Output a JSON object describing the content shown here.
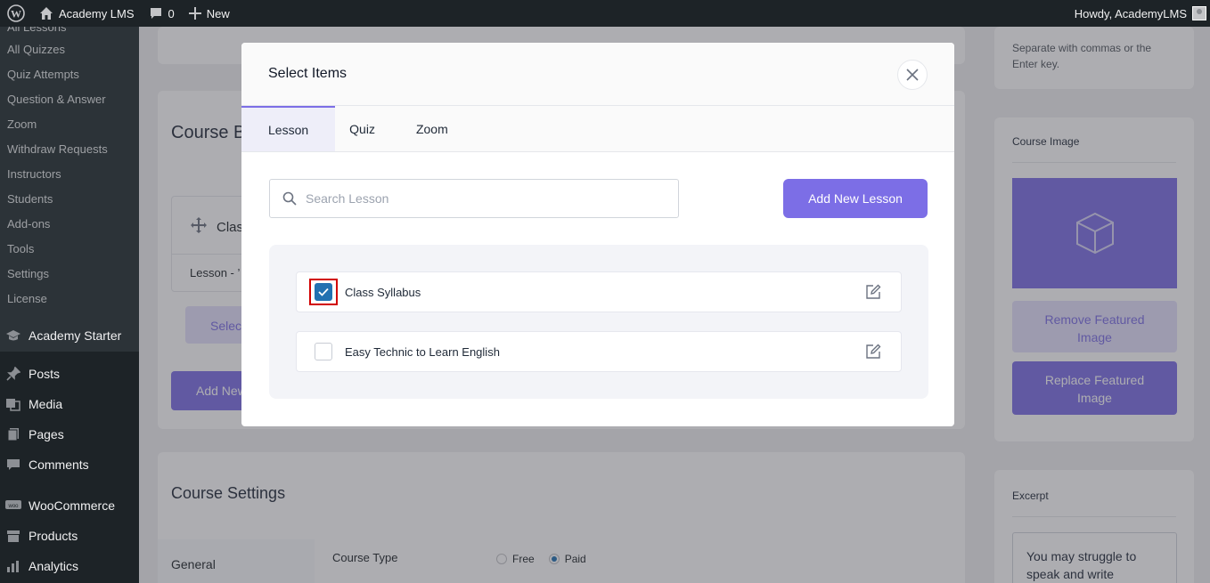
{
  "admin_bar": {
    "site_name": "Academy LMS",
    "comments_count": "0",
    "new_label": "New",
    "greeting": "Howdy, AcademyLMS"
  },
  "sidebar": {
    "partial_item": "All Lessons",
    "sub_items": [
      "All Quizzes",
      "Quiz Attempts",
      "Question & Answer",
      "Zoom",
      "Withdraw Requests",
      "Instructors",
      "Students",
      "Add-ons",
      "Tools",
      "Settings",
      "License"
    ],
    "menu_items": [
      {
        "label": "Academy Starter",
        "icon": "graduation-cap-icon"
      },
      {
        "label": "Posts",
        "icon": "pin-icon"
      },
      {
        "label": "Media",
        "icon": "media-icon"
      },
      {
        "label": "Pages",
        "icon": "pages-icon"
      },
      {
        "label": "Comments",
        "icon": "comment-icon"
      },
      {
        "label": "WooCommerce",
        "icon": "woo-icon"
      },
      {
        "label": "Products",
        "icon": "box-icon"
      },
      {
        "label": "Analytics",
        "icon": "chart-icon"
      }
    ]
  },
  "background": {
    "builder_title": "Course B",
    "topic_name": "Clas",
    "lesson_row": "Lesson - ’",
    "select_btn": "Selec",
    "add_new_btn": "Add New",
    "settings_title": "Course Settings",
    "settings_tab": "General",
    "course_type_label": "Course Type",
    "free_label": "Free",
    "paid_label": "Paid",
    "tags_hint": "Separate with commas or the Enter key.",
    "course_image_title": "Course Image",
    "remove_image_btn": "Remove Featured Image",
    "replace_image_btn": "Replace Featured Image",
    "excerpt_title": "Excerpt",
    "excerpt_text": "You may struggle to speak and write"
  },
  "modal": {
    "title": "Select Items",
    "tabs": [
      "Lesson",
      "Quiz",
      "Zoom"
    ],
    "active_tab": "Lesson",
    "search_placeholder": "Search Lesson",
    "add_button": "Add New Lesson",
    "items": [
      {
        "label": "Class Syllabus",
        "checked": true
      },
      {
        "label": "Easy Technic to Learn English",
        "checked": false
      }
    ]
  },
  "colors": {
    "accent": "#7c6ee6",
    "checkbox": "#2271b1",
    "highlight": "#d10000",
    "admin_bg": "#1d2327"
  }
}
